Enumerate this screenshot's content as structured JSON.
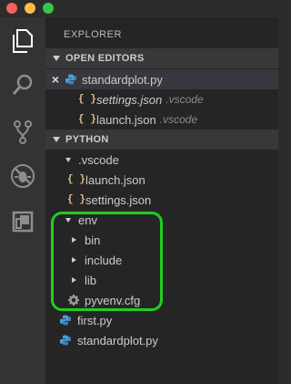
{
  "explorer": {
    "title": "EXPLORER"
  },
  "open_editors": {
    "header": "OPEN EDITORS",
    "items": [
      {
        "name": "standardplot.py",
        "folder": ""
      },
      {
        "name": "settings.json",
        "folder": ".vscode"
      },
      {
        "name": "launch.json",
        "folder": ".vscode"
      }
    ]
  },
  "workspace": {
    "header": "PYTHON",
    "vscode_folder": ".vscode",
    "vscode_files": [
      "launch.json",
      "settings.json"
    ],
    "env_folder": "env",
    "env_children": [
      "bin",
      "include",
      "lib"
    ],
    "env_file": "pyvenv.cfg",
    "root_files": [
      "first.py",
      "standardplot.py"
    ]
  },
  "icons": {
    "activity": [
      "files-icon",
      "search-icon",
      "source-control-icon",
      "debug-icon",
      "extensions-icon"
    ]
  },
  "colors": {
    "highlight": "#22cc22",
    "python": "#4a9fdc",
    "json_brace": "#e2c08d"
  }
}
